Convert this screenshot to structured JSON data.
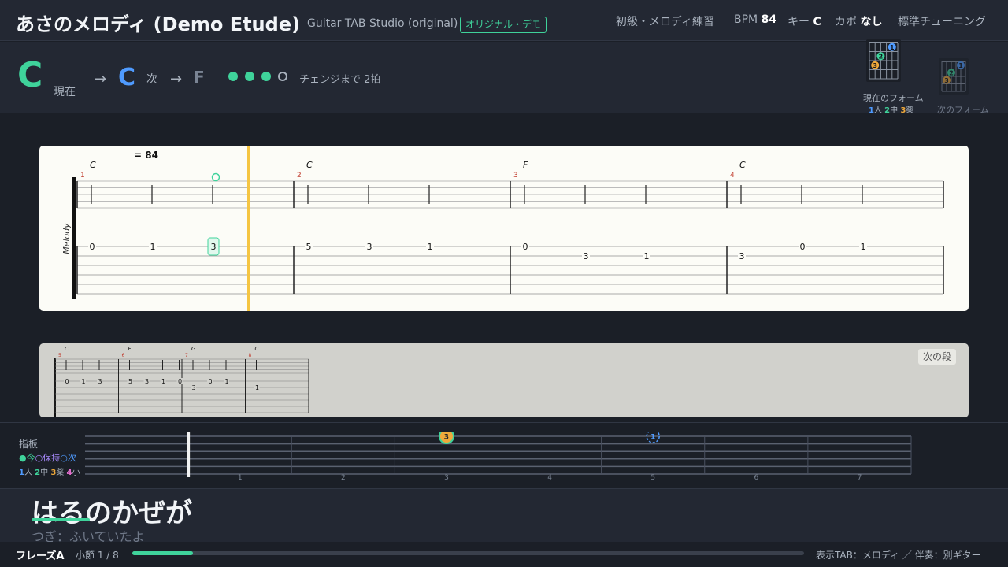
{
  "header": {
    "title": "あさのメロディ (Demo Etude)",
    "app_name": "Guitar TAB Studio (original)",
    "badge": "オリジナル・デモ",
    "mode": "初級・メロディ練習",
    "bpm_label": "BPM",
    "bpm_value": "84",
    "key_label": "キー",
    "key_value": "C",
    "capo_label": "カポ",
    "capo_value": "なし",
    "tuning": "標準チューニング"
  },
  "chord_bar": {
    "current_chord": "C",
    "current_label": "現在",
    "arrow": "→",
    "next_chord": "C",
    "next_label": "次",
    "after_chord": "F",
    "beats_filled": 3,
    "beats_total": 4,
    "change_text": "チェンジまで 2拍",
    "current_form_caption": "現在のフォーム",
    "next_form_caption": "次のフォーム",
    "finger_legend": {
      "n1": "1",
      "f1": "人",
      "n2": "2",
      "f2": "中",
      "n3": "3",
      "f3": "薬"
    },
    "chord_form_current": [
      {
        "string": 2,
        "fret": 1,
        "finger": "1"
      },
      {
        "string": 4,
        "fret": 2,
        "finger": "2"
      },
      {
        "string": 5,
        "fret": 3,
        "finger": "3"
      }
    ],
    "chord_form_next": [
      {
        "string": 2,
        "fret": 1,
        "finger": "1"
      },
      {
        "string": 4,
        "fret": 2,
        "finger": "2"
      },
      {
        "string": 5,
        "fret": 3,
        "finger": "3"
      }
    ]
  },
  "score": {
    "tempo_text": "= 84",
    "instrument_label": "Melody",
    "measures": [
      {
        "number": "1",
        "chord": "C",
        "notes": [
          {
            "fret": "0",
            "string": 1
          },
          {
            "fret": "1",
            "string": 1
          },
          {
            "fret": "3",
            "string": 1,
            "current": true
          }
        ]
      },
      {
        "number": "2",
        "chord": "C",
        "notes": [
          {
            "fret": "5",
            "string": 1
          },
          {
            "fret": "3",
            "string": 1
          },
          {
            "fret": "1",
            "string": 1
          }
        ]
      },
      {
        "number": "3",
        "chord": "F",
        "notes": [
          {
            "fret": "0",
            "string": 1
          },
          {
            "fret": "3",
            "string": 2
          },
          {
            "fret": "1",
            "string": 2
          }
        ]
      },
      {
        "number": "4",
        "chord": "C",
        "notes": [
          {
            "fret": "3",
            "string": 2
          },
          {
            "fret": "0",
            "string": 1
          },
          {
            "fret": "1",
            "string": 1
          }
        ]
      }
    ],
    "next_section_label": "次の段",
    "next_measures": [
      {
        "number": "5",
        "chord": "C",
        "notes": [
          {
            "fret": "0",
            "string": 1
          },
          {
            "fret": "1",
            "string": 1
          },
          {
            "fret": "3",
            "string": 1
          }
        ]
      },
      {
        "number": "6",
        "chord": "F",
        "notes": [
          {
            "fret": "5",
            "string": 1
          },
          {
            "fret": "3",
            "string": 1
          },
          {
            "fret": "1",
            "string": 1
          },
          {
            "fret": "0",
            "string": 1
          }
        ]
      },
      {
        "number": "7",
        "chord": "G",
        "notes": [
          {
            "fret": "3",
            "string": 2
          },
          {
            "fret": "0",
            "string": 1
          },
          {
            "fret": "1",
            "string": 1
          }
        ]
      },
      {
        "number": "8",
        "chord": "C",
        "notes": [
          {
            "fret": "1",
            "string": 2
          }
        ]
      }
    ]
  },
  "fretboard": {
    "title": "指板",
    "legend_now": "●今",
    "legend_hold": "○保持",
    "legend_next": "○次",
    "finger_legend": {
      "n1": "1",
      "f1": "人",
      "n2": "2",
      "f2": "中",
      "n3": "3",
      "f3": "薬",
      "n4": "4",
      "f4": "小"
    },
    "fret_numbers": [
      "1",
      "2",
      "3",
      "4",
      "5",
      "6",
      "7"
    ],
    "current_note": {
      "string": 1,
      "fret": 3,
      "finger": "3"
    },
    "next_note": {
      "string": 1,
      "fret": 5,
      "finger": "1"
    }
  },
  "lyrics": {
    "current_line": "はるのかぜが",
    "next_line": "つぎ：ふいていたよ"
  },
  "footer": {
    "phrase": "フレーズA",
    "measure_text": "小節 1 / 8",
    "progress": 0.09,
    "display_info": "表示TAB：メロディ ／ 伴奏：別ギター"
  },
  "colors": {
    "accent_green": "#3fd39b",
    "accent_blue": "#4f9bff",
    "accent_orange": "#f0a93b",
    "accent_pink": "#e86fd2",
    "playhead": "#f5c542",
    "measure_number": "#c0392b"
  }
}
